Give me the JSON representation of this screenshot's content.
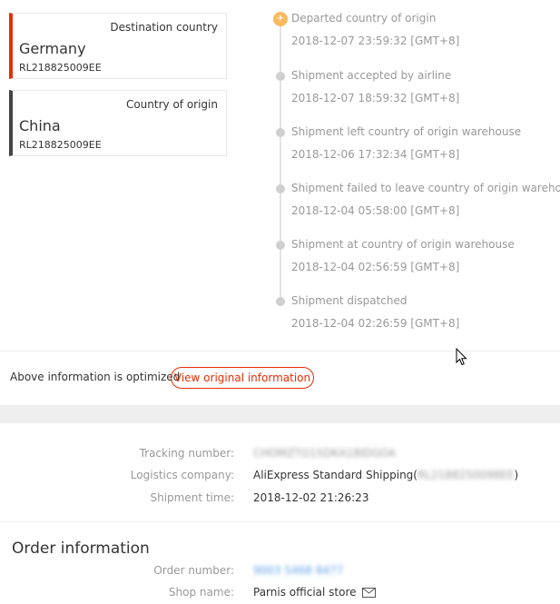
{
  "destination": {
    "role_label": "Destination country",
    "country": "Germany",
    "tracking": "RL218825009EE",
    "accent": "#e62e04"
  },
  "origin": {
    "role_label": "Country of origin",
    "country": "China",
    "tracking": "RL218825009EE",
    "accent": "#444444"
  },
  "timeline": [
    {
      "status": "Departed country of origin",
      "time": "2018-12-07 23:59:32 [GMT+8]",
      "icon": "plane-icon",
      "active": true
    },
    {
      "status": "Shipment accepted by airline",
      "time": "2018-12-07 18:59:32 [GMT+8]"
    },
    {
      "status": "Shipment left country of origin warehouse",
      "time": "2018-12-06 17:32:34 [GMT+8]"
    },
    {
      "status": "Shipment failed to leave country of origin warehouse",
      "time": "2018-12-04 05:58:00 [GMT+8]"
    },
    {
      "status": "Shipment at country of origin warehouse",
      "time": "2018-12-04 02:56:59 [GMT+8]"
    },
    {
      "status": "Shipment dispatched",
      "time": "2018-12-04 02:26:59 [GMT+8]"
    }
  ],
  "optimized_note": "Above information is optimized",
  "view_original_label": "View original information",
  "shipping": {
    "tracking_label": "Tracking number:",
    "tracking_value": "CHOMZTG15DKA18IDGOA",
    "logistics_label": "Logistics company:",
    "logistics_name": "AliExpress Standard Shipping(",
    "logistics_code": "RL2188250098EE",
    "logistics_close": ")",
    "shipment_time_label": "Shipment time:",
    "shipment_time_value": "2018-12-02 21:26:23"
  },
  "order": {
    "title": "Order information",
    "number_label": "Order number:",
    "number_value": "9003 5468 8477",
    "shop_label": "Shop name:",
    "shop_value": "Parnis official store",
    "shop_icon": "envelope-icon"
  },
  "colors": {
    "accent": "#e62e04",
    "timeline_active": "#f7ba5e",
    "timeline_dot": "#cfcfcf",
    "muted_text": "#999999",
    "link_blue": "#5aa0e6"
  }
}
